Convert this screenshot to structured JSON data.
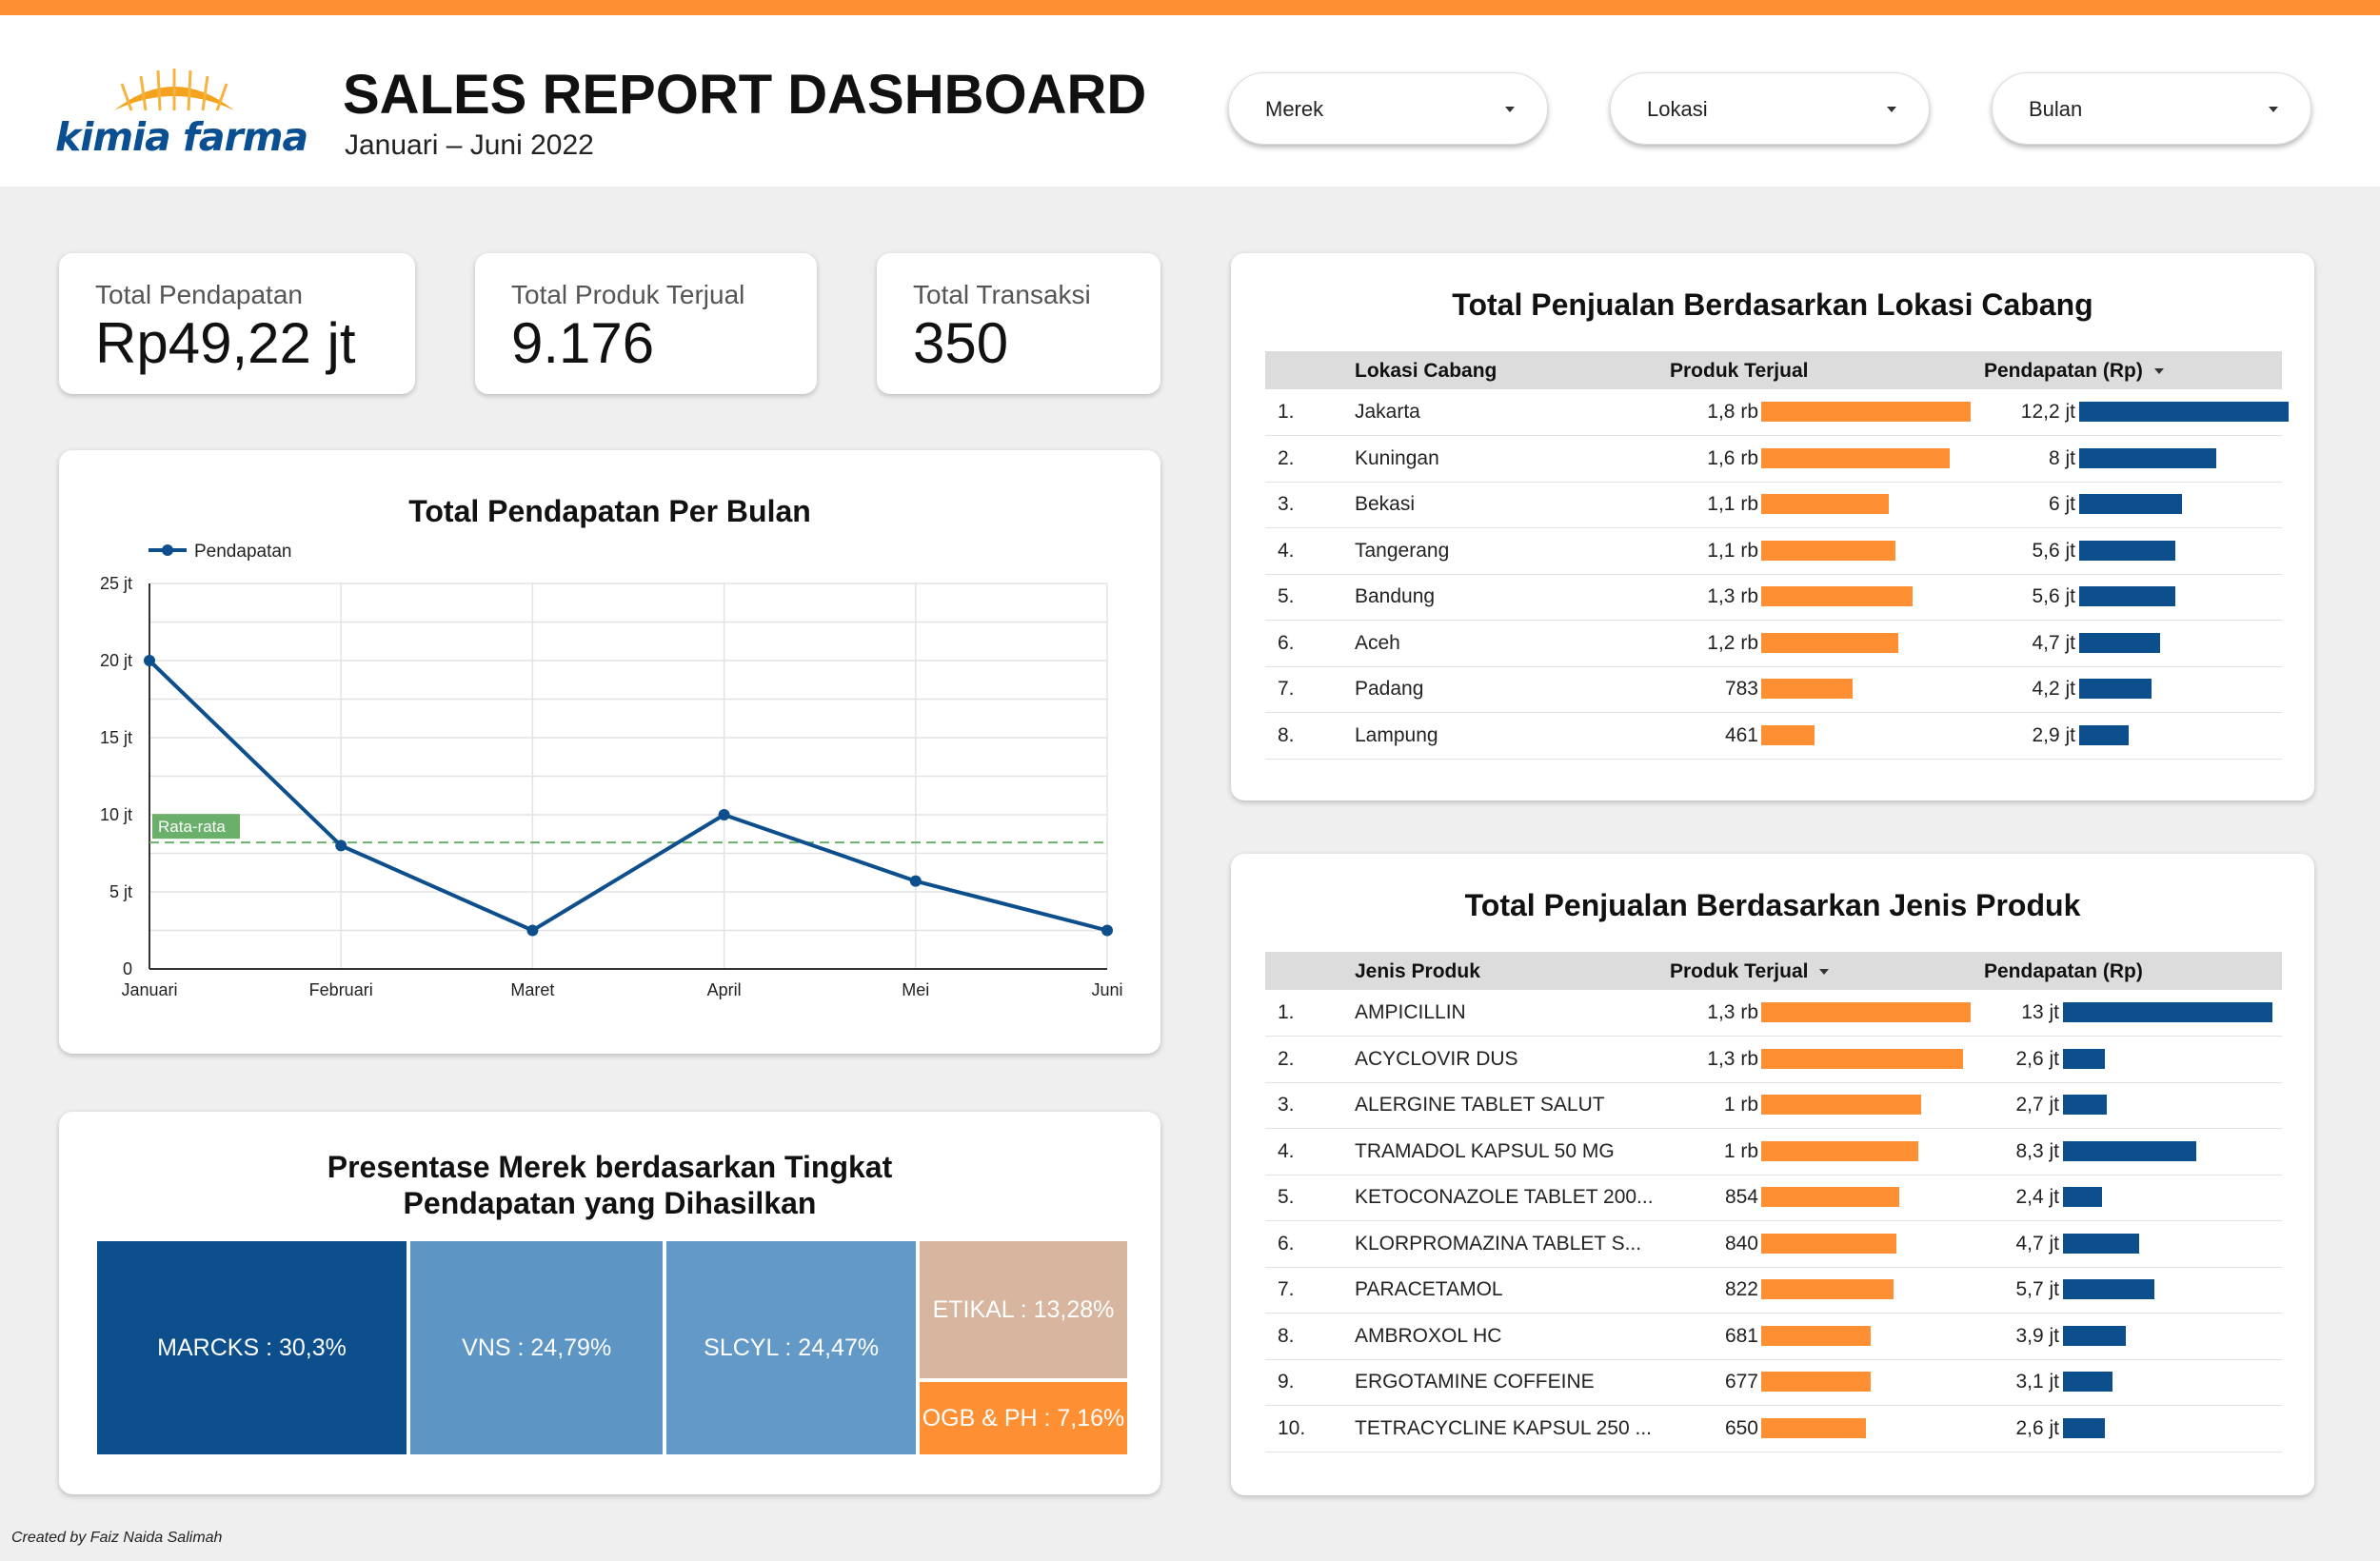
{
  "header": {
    "logo_text": "kimia farma",
    "title": "SALES REPORT DASHBOARD",
    "subtitle": "Januari – Juni 2022",
    "filters": [
      "Merek",
      "Lokasi",
      "Bulan"
    ]
  },
  "kpis": [
    {
      "label": "Total Pendapatan",
      "value": "Rp49,22 jt"
    },
    {
      "label": "Total Produk Terjual",
      "value": "9.176"
    },
    {
      "label": "Total Transaksi",
      "value": "350"
    }
  ],
  "colors": {
    "accent_orange": "#ff8f33",
    "navy": "#0d4f8c",
    "avg_line": "#6ab06a"
  },
  "chart_data": [
    {
      "type": "line",
      "title": "Total Pendapatan Per Bulan",
      "categories": [
        "Januari",
        "Februari",
        "Maret",
        "April",
        "Mei",
        "Juni"
      ],
      "series": [
        {
          "name": "Pendapatan",
          "values": [
            20,
            8,
            2.5,
            10,
            5.7,
            2.5
          ]
        }
      ],
      "unit": "jt",
      "ylim": [
        0,
        25
      ],
      "y_ticks": [
        "0",
        "5 jt",
        "10 jt",
        "15 jt",
        "20 jt",
        "25 jt"
      ],
      "average": {
        "label": "Rata-rata",
        "value": 8.2
      },
      "grid": true,
      "legend": "top-left"
    },
    {
      "type": "table",
      "title": "Total Penjualan Berdasarkan Lokasi Cabang",
      "columns": [
        "Lokasi Cabang",
        "Produk Terjual",
        "Pendapatan (Rp)"
      ],
      "rows": [
        {
          "no": "1.",
          "name": "Jakarta",
          "qty_label": "1,8 rb",
          "qty": 1800,
          "rev_label": "12,2 jt",
          "rev": 12.2
        },
        {
          "no": "2.",
          "name": "Kuningan",
          "qty_label": "1,6 rb",
          "qty": 1620,
          "rev_label": "8 jt",
          "rev": 8.0
        },
        {
          "no": "3.",
          "name": "Bekasi",
          "qty_label": "1,1 rb",
          "qty": 1100,
          "rev_label": "6 jt",
          "rev": 6.0
        },
        {
          "no": "4.",
          "name": "Tangerang",
          "qty_label": "1,1 rb",
          "qty": 1150,
          "rev_label": "5,6 jt",
          "rev": 5.6
        },
        {
          "no": "5.",
          "name": "Bandung",
          "qty_label": "1,3 rb",
          "qty": 1300,
          "rev_label": "5,6 jt",
          "rev": 5.6
        },
        {
          "no": "6.",
          "name": "Aceh",
          "qty_label": "1,2 rb",
          "qty": 1180,
          "rev_label": "4,7 jt",
          "rev": 4.7
        },
        {
          "no": "7.",
          "name": "Padang",
          "qty_label": "783",
          "qty": 783,
          "rev_label": "4,2 jt",
          "rev": 4.2
        },
        {
          "no": "8.",
          "name": "Lampung",
          "qty_label": "461",
          "qty": 461,
          "rev_label": "2,9 jt",
          "rev": 2.9
        }
      ],
      "qty_max": 1800,
      "rev_max": 12.2
    },
    {
      "type": "table",
      "title": "Total Penjualan Berdasarkan Jenis Produk",
      "columns": [
        "Jenis Produk",
        "Produk Terjual",
        "Pendapatan (Rp)"
      ],
      "rows": [
        {
          "no": "1.",
          "name": "AMPICILLIN",
          "qty_label": "1,3 rb",
          "qty": 1300,
          "rev_label": "13 jt",
          "rev": 13.0
        },
        {
          "no": "2.",
          "name": "ACYCLOVIR DUS",
          "qty_label": "1,3 rb",
          "qty": 1250,
          "rev_label": "2,6 jt",
          "rev": 2.6
        },
        {
          "no": "3.",
          "name": "ALERGINE TABLET SALUT",
          "qty_label": "1 rb",
          "qty": 990,
          "rev_label": "2,7 jt",
          "rev": 2.7
        },
        {
          "no": "4.",
          "name": "TRAMADOL KAPSUL 50 MG",
          "qty_label": "1 rb",
          "qty": 975,
          "rev_label": "8,3 jt",
          "rev": 8.3
        },
        {
          "no": "5.",
          "name": "KETOCONAZOLE TABLET 200...",
          "qty_label": "854",
          "qty": 854,
          "rev_label": "2,4 jt",
          "rev": 2.4
        },
        {
          "no": "6.",
          "name": "KLORPROMAZINA TABLET S...",
          "qty_label": "840",
          "qty": 840,
          "rev_label": "4,7 jt",
          "rev": 4.7
        },
        {
          "no": "7.",
          "name": "PARACETAMOL",
          "qty_label": "822",
          "qty": 822,
          "rev_label": "5,7 jt",
          "rev": 5.7
        },
        {
          "no": "8.",
          "name": "AMBROXOL HC",
          "qty_label": "681",
          "qty": 681,
          "rev_label": "3,9 jt",
          "rev": 3.9
        },
        {
          "no": "9.",
          "name": "ERGOTAMINE COFFEINE",
          "qty_label": "677",
          "qty": 677,
          "rev_label": "3,1 jt",
          "rev": 3.1
        },
        {
          "no": "10.",
          "name": "TETRACYCLINE KAPSUL 250 ...",
          "qty_label": "650",
          "qty": 650,
          "rev_label": "2,6 jt",
          "rev": 2.6
        }
      ],
      "qty_max": 1300,
      "rev_max": 13.0
    },
    {
      "type": "treemap",
      "title_line1": "Presentase Merek berdasarkan Tingkat",
      "title_line2": "Pendapatan yang Dihasilkan",
      "items": [
        {
          "label": "MARCKS : 30,3%",
          "value": 30.3,
          "color": "#0d4f8c"
        },
        {
          "label": "VNS : 24,79%",
          "value": 24.79,
          "color": "#5d95c4"
        },
        {
          "label": "SLCYL : 24,47%",
          "value": 24.47,
          "color": "#6399c6"
        },
        {
          "label": "ETIKAL : 13,28%",
          "value": 13.28,
          "color": "#d8b59e"
        },
        {
          "label": "OGB & PH : 7,16%",
          "value": 7.16,
          "color": "#ff8f33"
        }
      ]
    }
  ],
  "footer": "Created by Faiz Naida Salimah"
}
